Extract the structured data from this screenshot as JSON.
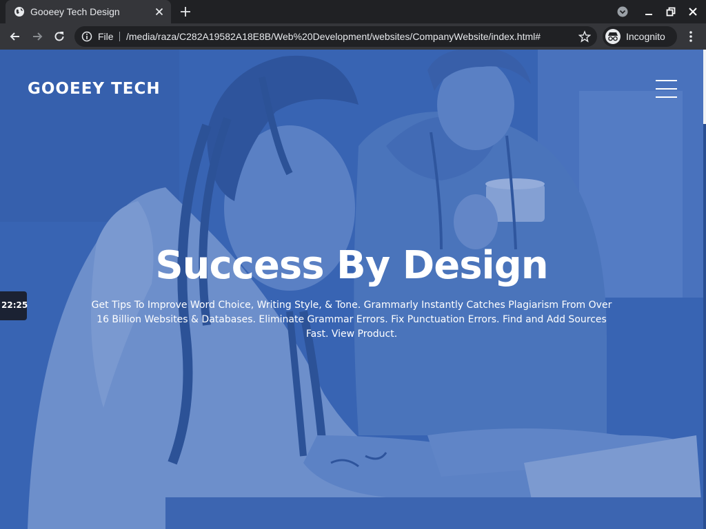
{
  "browser": {
    "tab_title": "Gooeey Tech Design",
    "omnibox_scheme": "File",
    "url": "/media/raza/C282A19582A18E8B/Web%20Development/websites/CompanyWebsite/index.html#",
    "incognito_label": "Incognito"
  },
  "page": {
    "brand": "GOOEEY TECH",
    "hero_title": "Success By Design",
    "hero_text": "Get Tips To Improve Word Choice, Writing Style, & Tone. Grammarly Instantly Catches Plagiarism From Over 16 Billion Websites & Databases. Eliminate Grammar Errors. Fix Punctuation Errors. Find and Add Sources Fast. View Product.",
    "clock_time": "22:25"
  },
  "icons": {
    "tab_favicon": "globe-icon",
    "tab_close": "close-icon",
    "new_tab": "plus-icon",
    "back": "arrow-left-icon",
    "forward": "arrow-right-icon",
    "reload": "reload-icon",
    "site_info": "info-icon",
    "bookmark": "star-icon",
    "incognito": "incognito-icon",
    "menu": "kebab-menu-icon",
    "nav_toggle": "hamburger-icon"
  },
  "colors": {
    "chrome_dark": "#202124",
    "chrome_toolbar": "#35363a",
    "hero_overlay": "#3462b6",
    "text_light": "#ffffff"
  }
}
